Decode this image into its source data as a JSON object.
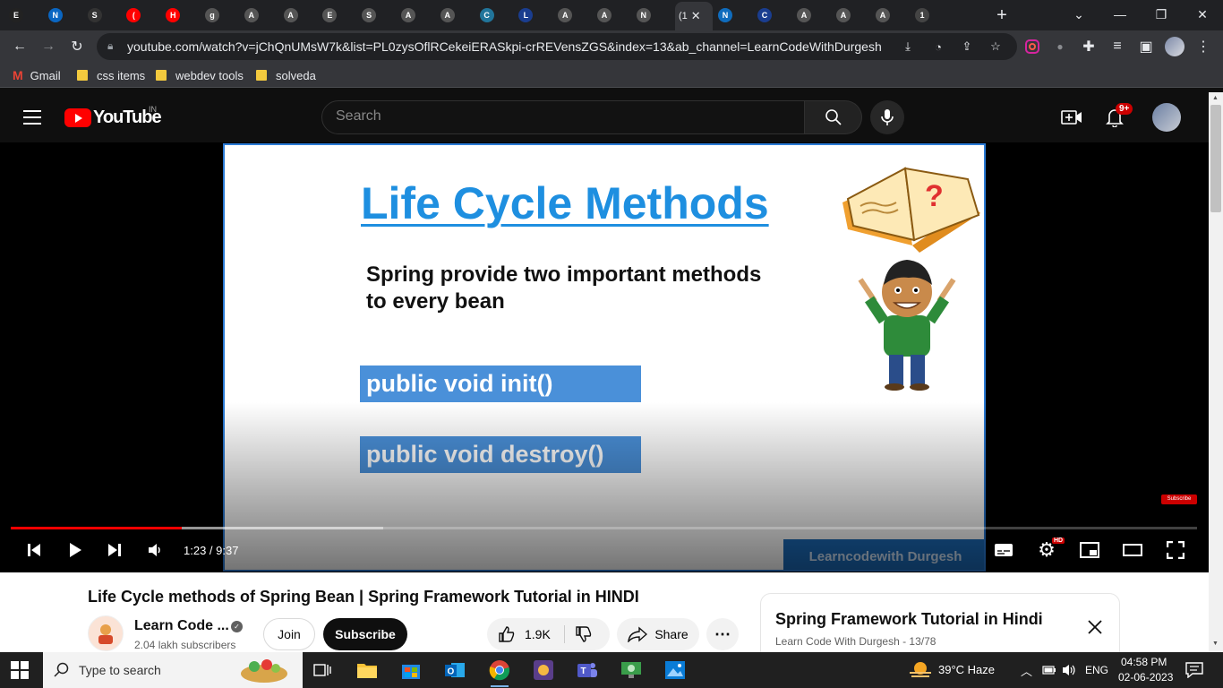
{
  "browser": {
    "tabs": [
      {
        "letter": "E",
        "color": "#222222"
      },
      {
        "letter": "N",
        "color": "#0a66c2"
      },
      {
        "letter": "S",
        "color": "#333333"
      },
      {
        "letter": "(",
        "color": "#ff0000"
      },
      {
        "letter": "H",
        "color": "#ff0000"
      },
      {
        "letter": "g",
        "color": "#555555"
      },
      {
        "letter": "A",
        "color": "#555555"
      },
      {
        "letter": "A",
        "color": "#555555"
      },
      {
        "letter": "E",
        "color": "#555555"
      },
      {
        "letter": "S",
        "color": "#555555"
      },
      {
        "letter": "A",
        "color": "#555555"
      },
      {
        "letter": "A",
        "color": "#555555"
      },
      {
        "letter": "C",
        "color": "#21759b"
      },
      {
        "letter": "L",
        "color": "#1a3d8f"
      },
      {
        "letter": "A",
        "color": "#555555"
      },
      {
        "letter": "A",
        "color": "#555555"
      },
      {
        "letter": "N",
        "color": "#555555"
      }
    ],
    "active_tab_label": "(1",
    "tabs_after": [
      {
        "letter": "N",
        "color": "#0f6cbd"
      },
      {
        "letter": "C",
        "color": "#1a3d8f"
      },
      {
        "letter": "A",
        "color": "#555555"
      },
      {
        "letter": "A",
        "color": "#555555"
      },
      {
        "letter": "A",
        "color": "#555555"
      },
      {
        "letter": "1",
        "color": "#444444"
      }
    ],
    "url": "youtube.com/watch?v=jChQnUMsW7k&list=PL0zysOflRCekeiERASkpi-crREVensZGS&index=13&ab_channel=LearnCodeWithDurgesh",
    "bookmarks": [
      "Gmail",
      "css items",
      "webdev tools",
      "solveda"
    ]
  },
  "youtube": {
    "logo_text": "YouTube",
    "country_code": "IN",
    "search_placeholder": "Search",
    "notifications": "9+"
  },
  "slide": {
    "title": "Life Cycle Methods",
    "subtitle_line1": "Spring provide two important methods",
    "subtitle_line2": "to every bean",
    "method1": "public void init()",
    "method2": "public void destroy()",
    "brand": "Learncodewith Durgesh",
    "subscribe_badge": "Subscribe"
  },
  "player": {
    "time": "1:23 / 9:37",
    "played_fraction": 0.144,
    "buffered_fraction": 0.314,
    "quality_badge": "HD"
  },
  "video": {
    "title": "Life Cycle methods of Spring Bean | Spring Framework Tutorial in HINDI",
    "channel_name": "Learn Code ...",
    "subscribers": "2.04 lakh subscribers",
    "join_label": "Join",
    "subscribe_label": "Subscribe",
    "likes": "1.9K",
    "share_label": "Share"
  },
  "playlist": {
    "title": "Spring Framework Tutorial in Hindi",
    "subtitle": "Learn Code With Durgesh - 13/78"
  },
  "taskbar": {
    "search_placeholder": "Type to search",
    "weather": "39°C  Haze",
    "language": "ENG",
    "time": "04:58 PM",
    "date": "02-06-2023"
  }
}
